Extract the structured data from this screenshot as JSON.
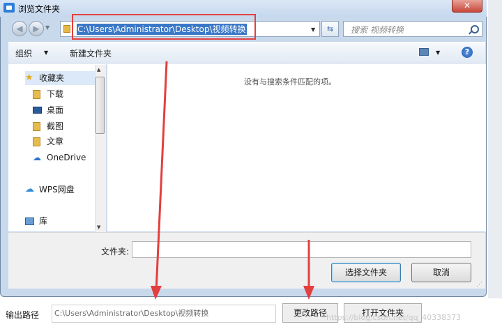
{
  "dialog": {
    "title": "浏览文件夹",
    "close_label": "✕",
    "address_path": "C:\\Users\\Administrator\\Desktop\\视频转换",
    "search_placeholder": "搜索 视频转换",
    "toolbar": {
      "organize_label": "组织",
      "new_folder_label": "新建文件夹"
    },
    "sidebar": {
      "items": [
        {
          "label": "收藏夹",
          "icon": "star-icon"
        },
        {
          "label": "下载",
          "icon": "folder-icon"
        },
        {
          "label": "桌面",
          "icon": "desktop-icon"
        },
        {
          "label": "截图",
          "icon": "folder-icon"
        },
        {
          "label": "文章",
          "icon": "folder-icon"
        },
        {
          "label": "OneDrive",
          "icon": "cloud-icon"
        },
        {
          "label": "WPS网盘",
          "icon": "cloud-icon"
        },
        {
          "label": "库",
          "icon": "library-icon"
        }
      ]
    },
    "empty_message": "没有与搜索条件匹配的项。",
    "folder_label": "文件夹:",
    "folder_value": "",
    "select_button": "选择文件夹",
    "cancel_button": "取消"
  },
  "app": {
    "output_label": "输出路径",
    "output_path": "C:\\Users\\Administrator\\Desktop\\视频转换",
    "change_path_button": "更改路径",
    "open_folder_button": "打开文件夹",
    "watermark": "https://blog.csdn.net/qq_40338373"
  },
  "colors": {
    "highlight_box": "#e43f3f",
    "arrow": "#e43f3f",
    "selection": "#3a78c8"
  }
}
